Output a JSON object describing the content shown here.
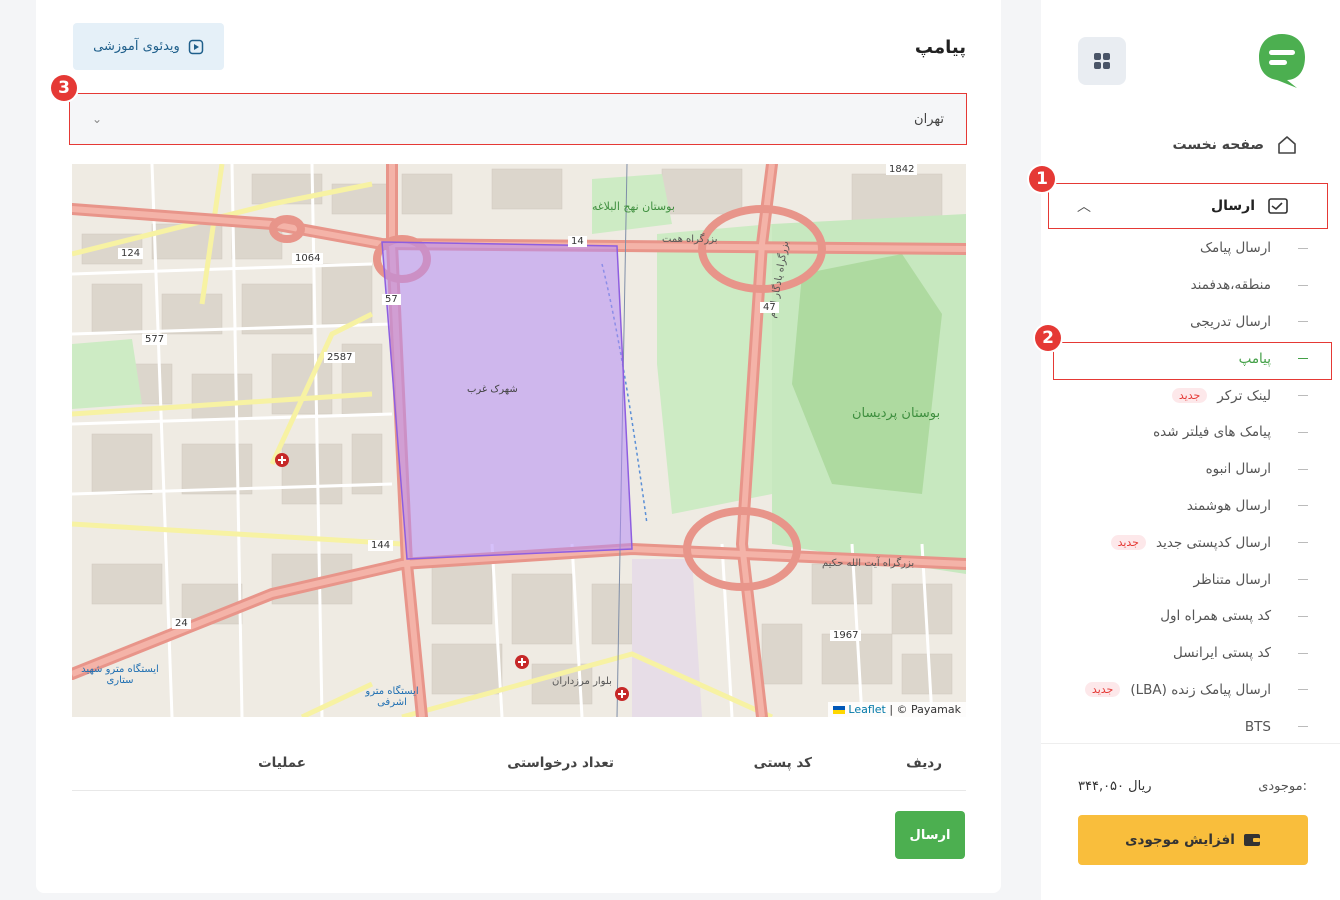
{
  "sidebar": {
    "home": "صفحه نخست",
    "send": "ارسال",
    "items": [
      {
        "label": "ارسال پیامک",
        "badge": ""
      },
      {
        "label": "منطقه،هدفمند",
        "badge": ""
      },
      {
        "label": "ارسال تدریجی",
        "badge": ""
      },
      {
        "label": "پیامپ",
        "badge": ""
      },
      {
        "label": "لینک ترکر",
        "badge": "جدید"
      },
      {
        "label": "پیامک های فیلتر شده",
        "badge": ""
      },
      {
        "label": "ارسال انبوه",
        "badge": ""
      },
      {
        "label": "ارسال هوشمند",
        "badge": ""
      },
      {
        "label": "ارسال کدپستی جدید",
        "badge": "جدید"
      },
      {
        "label": "ارسال متناظر",
        "badge": ""
      },
      {
        "label": "کد پستی همراه اول",
        "badge": ""
      },
      {
        "label": "کد پستی ایرانسل",
        "badge": ""
      },
      {
        "label": "ارسال پیامک زنده (LBA)",
        "badge": "جدید"
      },
      {
        "label": "BTS",
        "badge": ""
      }
    ],
    "balance_label": "موجودی:",
    "balance_value": "۳۴۴,۰۵۰ ریال",
    "topup_label": "افزایش موجودی"
  },
  "main": {
    "title": "پیامپ",
    "video_button": "ویدئوی آموزشی",
    "city": "تهران",
    "map": {
      "attribution_link": "Leaflet",
      "attribution_text": "| © Payamak",
      "labels": [
        "بزرگراه همت",
        "بزرگراه آیت الله حکیم",
        "بزرگراه یادگار امام",
        "بوستان پردیسان",
        "بوستان نهج البلاغه",
        "شهرک غرب",
        "بلوار مرزداران",
        "ایستگاه مترو شهید ستاری",
        "ایستگاه مترو اشرفی",
        "24",
        "47",
        "14",
        "1064",
        "2587",
        "577",
        "124",
        "1842",
        "144",
        "1967",
        "57"
      ]
    },
    "table_headers": {
      "row": "ردیف",
      "postal": "کد پستی",
      "count": "تعداد درخواستی",
      "ops": "عملیات"
    },
    "send_button": "ارسال"
  },
  "annotations": [
    "1",
    "2",
    "3"
  ],
  "colors": {
    "accent_green": "#4caf50",
    "highlight_red": "#e53935",
    "topup_yellow": "#f9be3c",
    "polygon": "#b58cf5"
  }
}
